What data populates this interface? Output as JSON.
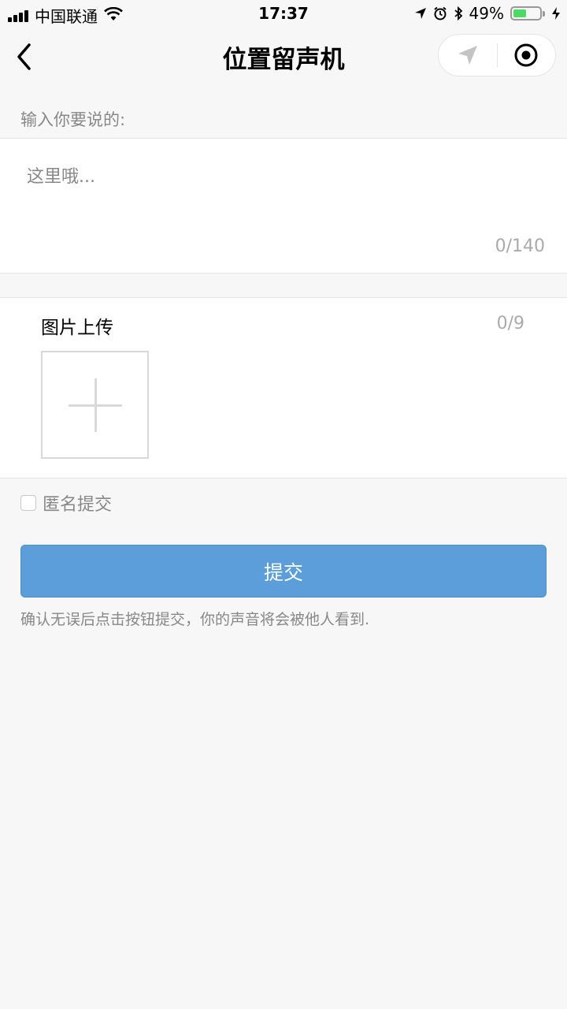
{
  "status_bar": {
    "carrier": "中国联通",
    "time": "17:37",
    "battery_percent": "49%",
    "battery_level": 0.49
  },
  "nav": {
    "title": "位置留声机"
  },
  "form": {
    "message_label": "输入你要说的:",
    "message_placeholder": "这里哦...",
    "char_count": "0/140",
    "upload_title": "图片上传",
    "upload_count": "0/9",
    "anonymous_label": "匿名提交",
    "submit_label": "提交",
    "hint": "确认无误后点击按钮提交，你的声音将会被他人看到."
  },
  "colors": {
    "accent": "#5b9ed9",
    "background": "#f7f7f7",
    "battery_fill": "#4cd964"
  },
  "icons": {
    "back": "chevron-left-icon",
    "location": "location-arrow-icon",
    "close": "target-circle-icon"
  }
}
